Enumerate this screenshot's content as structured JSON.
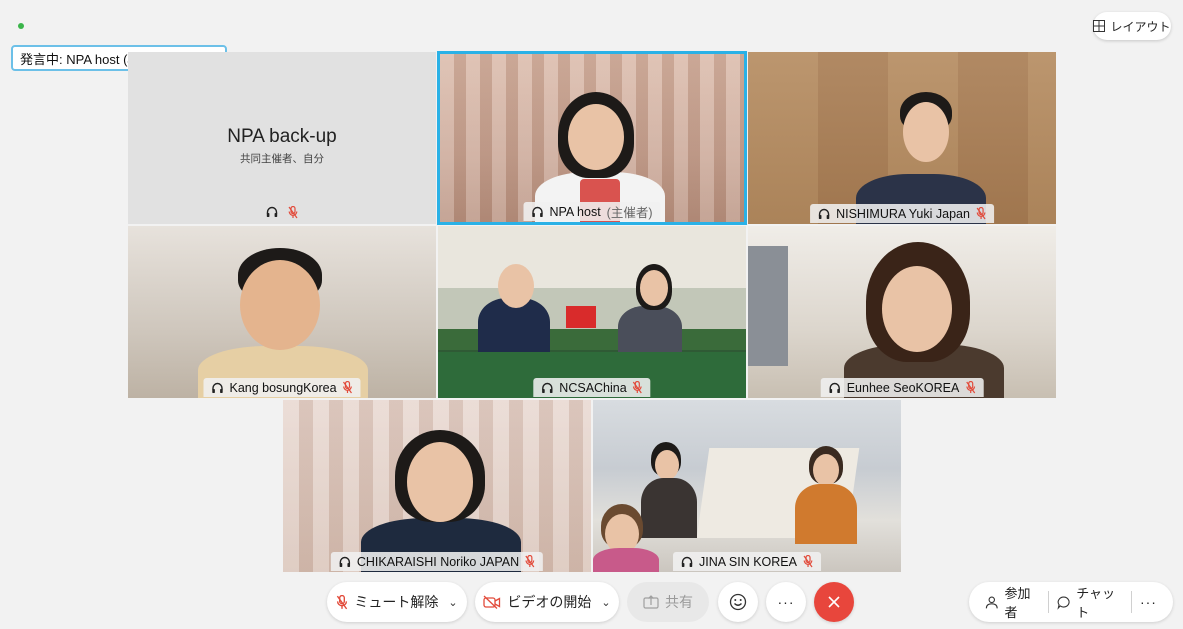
{
  "speaker_banner": "発言中: NPA host (Japan) (主催者)",
  "layout_button": "レイアウト",
  "tiles": {
    "backup": {
      "name": "NPA back-up",
      "subtitle": "共同主催者、自分"
    },
    "host": {
      "name": "NPA host",
      "role": "(主催者)"
    },
    "nishimura": {
      "name": "NISHIMURA Yuki Japan"
    },
    "kang": {
      "name": "Kang bosungKorea"
    },
    "ncsa": {
      "name": "NCSAChina"
    },
    "eunhee": {
      "name": "Eunhee SeoKOREA"
    },
    "chikaraishi": {
      "name": "CHIKARAISHI Noriko JAPAN"
    },
    "jina": {
      "name": "JINA SIN KOREA"
    }
  },
  "toolbar": {
    "unmute": "ミュート解除",
    "start_video": "ビデオの開始",
    "share": "共有",
    "more": "···",
    "participants": "参加者",
    "chat": "チャット",
    "overflow": "···"
  },
  "colors": {
    "accent": "#2ab1e6",
    "end_call": "#e8463c",
    "muted_mic": "#e24b3b"
  }
}
